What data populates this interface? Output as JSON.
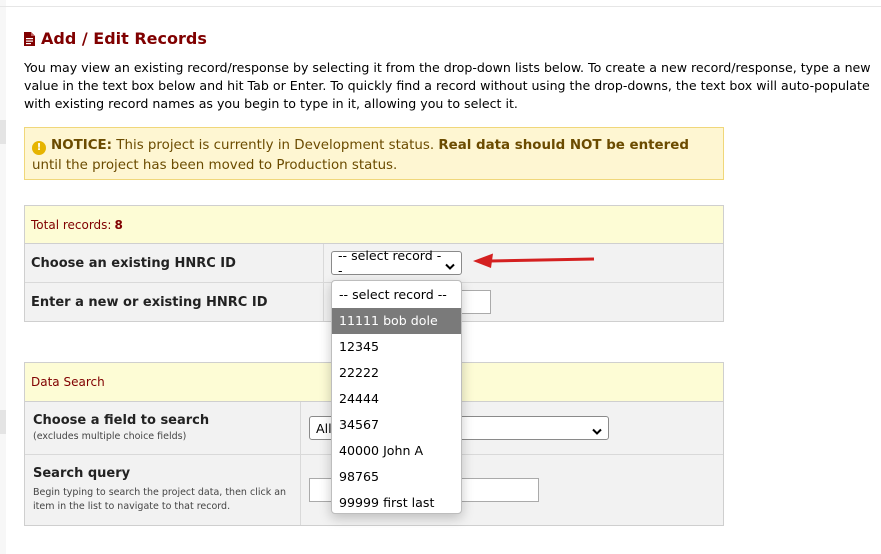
{
  "page_title": "Add / Edit Records",
  "intro": "You may view an existing record/response by selecting it from the drop-down lists below. To create a new record/response, type a new value in the text box below and hit Tab or Enter. To quickly find a record without using the drop-downs, the text box will auto-populate with existing record names as you begin to type in it, allowing you to select it.",
  "notice": {
    "label": "NOTICE:",
    "text1": " This project is currently in Development status. ",
    "bold": "Real data should NOT be entered",
    "text2": " until the project has been moved to Production status."
  },
  "records_panel": {
    "total_label": "Total records: ",
    "total_count": "8",
    "choose_label": "Choose an existing HNRC ID",
    "enter_label": "Enter a new or existing HNRC ID",
    "select_value": "-- select record --"
  },
  "dropdown": {
    "options": [
      "-- select record --",
      "11111 bob dole",
      "12345",
      "22222",
      "24444",
      "34567",
      "40000 John A",
      "98765",
      "99999 first last"
    ],
    "highlighted_index": 1
  },
  "search_panel": {
    "header": "Data Search",
    "field_label": "Choose a field to search",
    "field_sub": "(excludes multiple choice fields)",
    "field_value": "All",
    "query_label": "Search query",
    "query_sub": "Begin typing to search the project data, then click an item in the list to navigate to that record."
  },
  "colors": {
    "title": "#800000",
    "notice_bg": "#fef6d2",
    "panel_header_bg": "#fdfcd5",
    "arrow": "#d42020",
    "highlight": "#7a7a7a"
  }
}
